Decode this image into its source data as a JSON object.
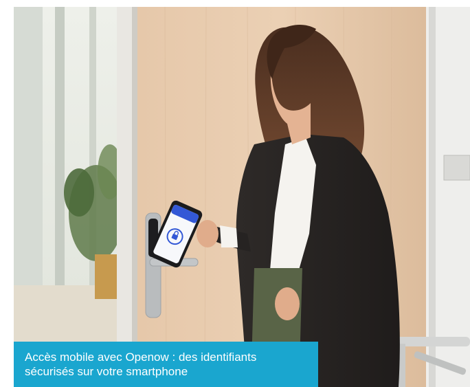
{
  "photo": {
    "subject": "woman-unlocking-door-with-smartphone",
    "phone_icon": "lock-icon"
  },
  "caption": {
    "line1": "Accès mobile avec Openow : des identifiants",
    "line2": "sécurisés sur votre smartphone"
  },
  "colors": {
    "caption_background": "#1aa6cf",
    "caption_text": "#ffffff"
  }
}
